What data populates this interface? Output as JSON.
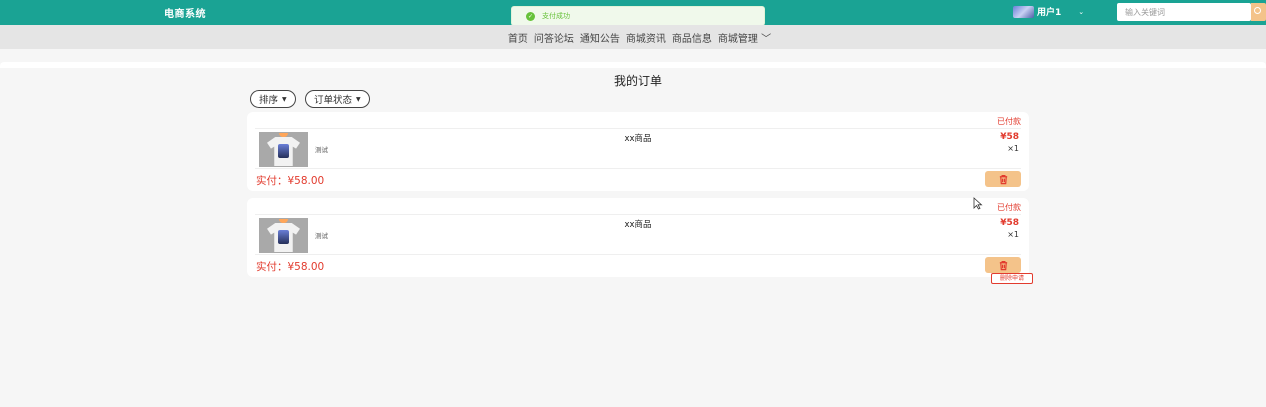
{
  "header": {
    "brand": "电商系统",
    "user_name": "用户1",
    "user_caret": "⌄",
    "search_placeholder": "输入关键词",
    "accent_color": "#1aa394"
  },
  "toast": {
    "text": "支付成功",
    "icon": "check-circle-icon"
  },
  "nav": {
    "items": [
      {
        "label": "首页"
      },
      {
        "label": "问答论坛"
      },
      {
        "label": "通知公告"
      },
      {
        "label": "商城资讯"
      },
      {
        "label": "商品信息"
      },
      {
        "label": "商城管理 ﹀"
      }
    ]
  },
  "page": {
    "title": "我的订单",
    "sort_label": "排序",
    "status_filter_label": "订单状态"
  },
  "orders": [
    {
      "status": "已付款",
      "product_name": "xx商品",
      "description": "测试",
      "price": "¥58",
      "quantity": "×1",
      "paid_label": "实付：",
      "paid_amount": "¥58.00"
    },
    {
      "status": "已付款",
      "product_name": "xx商品",
      "description": "测试",
      "price": "¥58",
      "quantity": "×1",
      "paid_label": "实付：",
      "paid_amount": "¥58.00"
    }
  ],
  "tooltip": {
    "text": "删除申请"
  },
  "colors": {
    "status_red": "#e23b2e",
    "delete_button": "#f4c38a"
  }
}
